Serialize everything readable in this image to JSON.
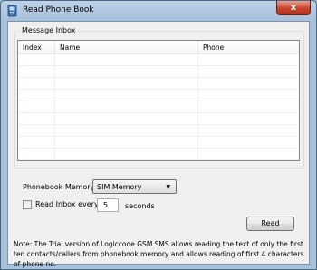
{
  "window": {
    "title": "Read Phone Book",
    "close_label": "x"
  },
  "inbox_group": {
    "label": "Message Inbox",
    "columns": [
      "Index",
      "Name",
      "Phone"
    ],
    "rows": []
  },
  "phonebook": {
    "label": "Phonebook Memory:",
    "selected": "SIM Memory"
  },
  "read_every": {
    "label": "Read Inbox every",
    "checked": false,
    "value": "5",
    "unit": "seconds"
  },
  "actions": {
    "read_label": "Read"
  },
  "note": "Note: The Trial version of Logiccode GSM SMS allows reading the text of only the first ten contacts/callers from phonebook memory and allows reading of first 4 characters of phone no."
}
